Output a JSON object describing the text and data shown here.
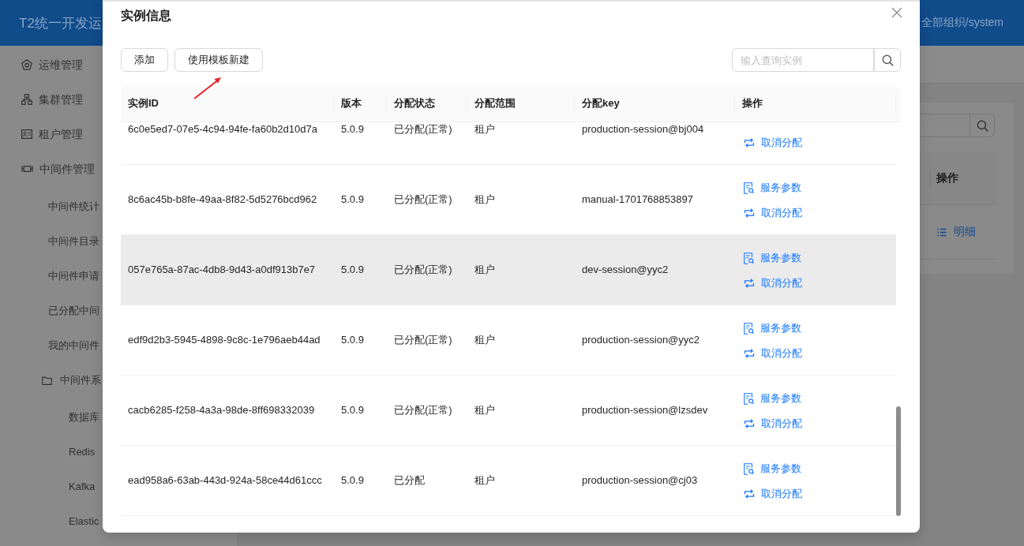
{
  "header": {
    "title": "T2统一开发运",
    "org": "全部组织/system"
  },
  "sidebar": {
    "items": [
      {
        "label": "运维管理",
        "kind": "menu"
      },
      {
        "label": "集群管理",
        "kind": "menu"
      },
      {
        "label": "租户管理",
        "kind": "menu"
      },
      {
        "label": "中间件管理",
        "kind": "menu",
        "children": [
          {
            "label": "中间件统计",
            "kind": "page"
          },
          {
            "label": "中间件目录",
            "kind": "page"
          },
          {
            "label": "中间件申请",
            "kind": "page"
          },
          {
            "label": "已分配中间",
            "kind": "page"
          },
          {
            "label": "我的中间件",
            "kind": "page"
          },
          {
            "label": "中间件系",
            "kind": "folder",
            "children": [
              {
                "label": "数据库",
                "kind": "page"
              },
              {
                "label": "Redis",
                "kind": "page"
              },
              {
                "label": "Kafka",
                "kind": "page"
              },
              {
                "label": "Elastic",
                "kind": "page"
              }
            ]
          }
        ]
      }
    ]
  },
  "background_panel": {
    "columns": [
      "操作"
    ],
    "rows": [
      {
        "action": "明细"
      }
    ]
  },
  "dialog": {
    "title": "实例信息",
    "buttons": [
      "添加",
      "使用模板新建"
    ],
    "search": {
      "placeholder": "输入查询实例"
    },
    "table": {
      "columns": [
        "实例ID",
        "版本",
        "分配状态",
        "分配范围",
        "分配key",
        "操作"
      ],
      "rows": [
        {
          "id": "6c0e5ed7-07e5-4c94-94fe-fa60b2d10d7a",
          "version": "5.0.9",
          "status": "已分配(正常)",
          "scope": "租户",
          "key": "production-session@bj004",
          "hovered": false,
          "actions": [
            {
              "kind": "unassign",
              "label": "取消分配"
            }
          ]
        },
        {
          "id": "8c6ac45b-b8fe-49aa-8f82-5d5276bcd962",
          "version": "5.0.9",
          "status": "已分配(正常)",
          "scope": "租户",
          "key": "manual-1701768853897",
          "hovered": false,
          "actions": [
            {
              "kind": "params",
              "label": "服务参数"
            },
            {
              "kind": "unassign",
              "label": "取消分配"
            }
          ]
        },
        {
          "id": "057e765a-87ac-4db8-9d43-a0df913b7e7",
          "version": "5.0.9",
          "status": "已分配(正常)",
          "scope": "租户",
          "key": "dev-session@yyc2",
          "hovered": true,
          "actions": [
            {
              "kind": "params",
              "label": "服务参数"
            },
            {
              "kind": "unassign",
              "label": "取消分配"
            }
          ]
        },
        {
          "id": "edf9d2b3-5945-4898-9c8c-1e796aeb44ad",
          "version": "5.0.9",
          "status": "已分配(正常)",
          "scope": "租户",
          "key": "production-session@yyc2",
          "hovered": false,
          "actions": [
            {
              "kind": "params",
              "label": "服务参数"
            },
            {
              "kind": "unassign",
              "label": "取消分配"
            }
          ]
        },
        {
          "id": "cacb6285-f258-4a3a-98de-8ff698332039",
          "version": "5.0.9",
          "status": "已分配(正常)",
          "scope": "租户",
          "key": "production-session@lzsdev",
          "hovered": false,
          "actions": [
            {
              "kind": "params",
              "label": "服务参数"
            },
            {
              "kind": "unassign",
              "label": "取消分配"
            }
          ]
        },
        {
          "id": "ead958a6-63ab-443d-924a-58ce44d61ccc",
          "version": "5.0.9",
          "status": "已分配",
          "scope": "租户",
          "key": "production-session@cj03",
          "hovered": false,
          "actions": [
            {
              "kind": "params",
              "label": "服务参数"
            },
            {
              "kind": "unassign",
              "label": "取消分配"
            }
          ]
        }
      ]
    }
  }
}
